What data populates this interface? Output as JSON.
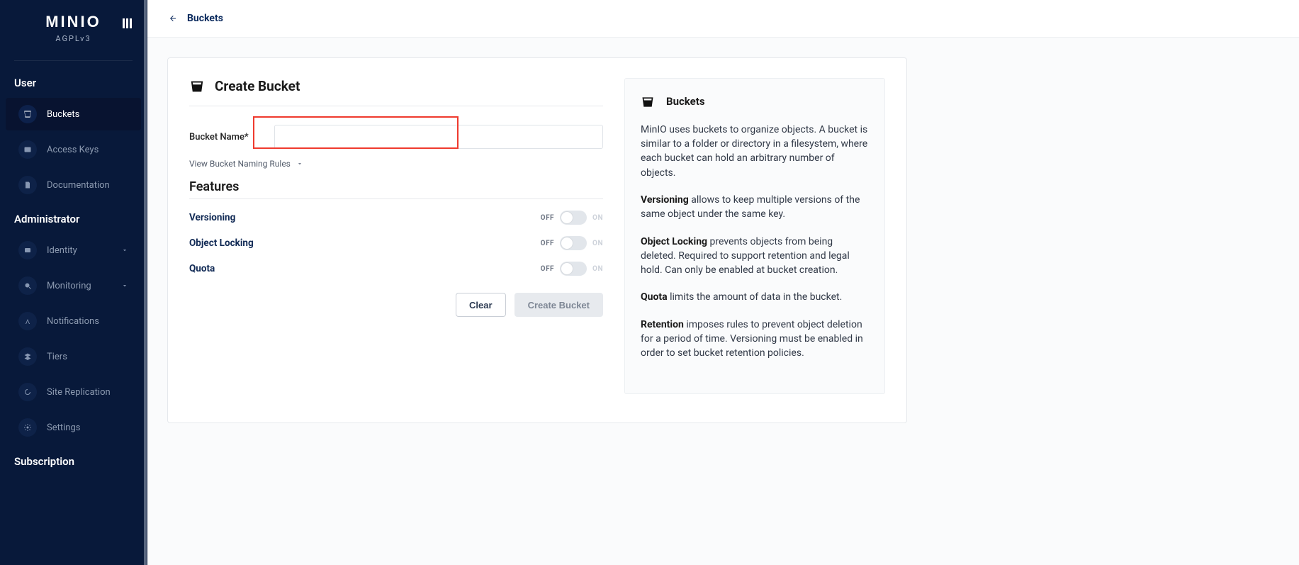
{
  "brand": {
    "name": "MINIO",
    "sub": "AGPLv3"
  },
  "sidebar": {
    "sections": [
      {
        "title": "User",
        "items": [
          {
            "label": "Buckets",
            "active": true
          },
          {
            "label": "Access Keys",
            "active": false
          },
          {
            "label": "Documentation",
            "active": false
          }
        ]
      },
      {
        "title": "Administrator",
        "items": [
          {
            "label": "Identity",
            "caret": true
          },
          {
            "label": "Monitoring",
            "caret": true
          },
          {
            "label": "Notifications"
          },
          {
            "label": "Tiers"
          },
          {
            "label": "Site Replication"
          },
          {
            "label": "Settings"
          }
        ]
      },
      {
        "title": "Subscription",
        "items": []
      }
    ]
  },
  "topbar": {
    "back_label": "Buckets"
  },
  "form": {
    "heading": "Create Bucket",
    "bucket_name_label": "Bucket Name*",
    "bucket_name_value": "",
    "rules_link": "View Bucket Naming Rules",
    "features_heading": "Features",
    "features": [
      {
        "name": "Versioning",
        "off": "OFF",
        "on": "ON"
      },
      {
        "name": "Object Locking",
        "off": "OFF",
        "on": "ON"
      },
      {
        "name": "Quota",
        "off": "OFF",
        "on": "ON"
      }
    ],
    "clear": "Clear",
    "create": "Create Bucket"
  },
  "info": {
    "title": "Buckets",
    "p1": "MinIO uses buckets to organize objects. A bucket is similar to a folder or directory in a filesystem, where each bucket can hold an arbitrary number of objects.",
    "p2a": "Versioning",
    "p2b": " allows to keep multiple versions of the same object under the same key.",
    "p3a": "Object Locking",
    "p3b": " prevents objects from being deleted. Required to support retention and legal hold. Can only be enabled at bucket creation.",
    "p4a": "Quota",
    "p4b": " limits the amount of data in the bucket.",
    "p5a": "Retention",
    "p5b": " imposes rules to prevent object deletion for a period of time. Versioning must be enabled in order to set bucket retention policies."
  }
}
